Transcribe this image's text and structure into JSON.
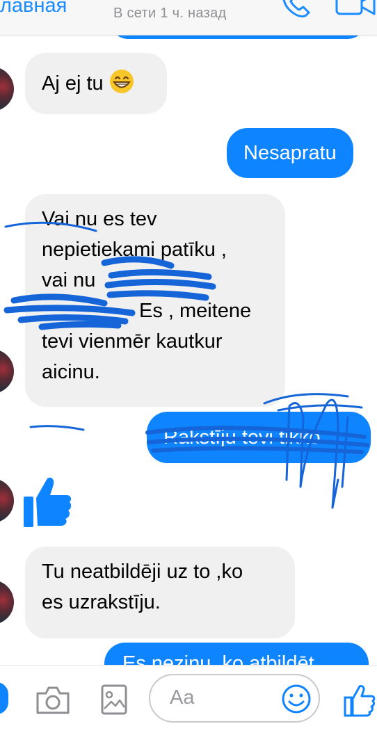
{
  "header": {
    "back_label": "лавная",
    "status": "В сети 1 ч. назад",
    "call_icon": "phone-icon",
    "video_icon": "video-camera-icon"
  },
  "messages": [
    {
      "direction": "in",
      "text": "Aj ej tu",
      "emoji": "grinning-face-icon"
    },
    {
      "direction": "out",
      "text": "Nesapratu"
    },
    {
      "direction": "in",
      "lines": [
        "Vai nu es tev",
        "nepietiekami patīku ,",
        "vai nu",
        "Es , meitene",
        "tevi vienmēr kautkur",
        "aicinu."
      ]
    },
    {
      "direction": "out",
      "text": "Rakstīju tevi tikko"
    },
    {
      "direction": "in",
      "type": "like",
      "icon": "thumbs-up-icon"
    },
    {
      "direction": "in",
      "lines": [
        "Tu neatbildēji uz to ,ko",
        "es uzrakstīju."
      ]
    },
    {
      "direction": "out",
      "text": "Es nezinu, ko atbildēt"
    }
  ],
  "composer": {
    "placeholder": "Aa",
    "camera_icon": "camera-icon",
    "gallery_icon": "image-gallery-icon",
    "emoji_icon": "smile-icon",
    "like_icon": "thumbs-up-icon"
  },
  "colors": {
    "accent": "#0f84ff",
    "incoming_bubble": "#f1f0f0",
    "scribble": "#1565d8"
  }
}
